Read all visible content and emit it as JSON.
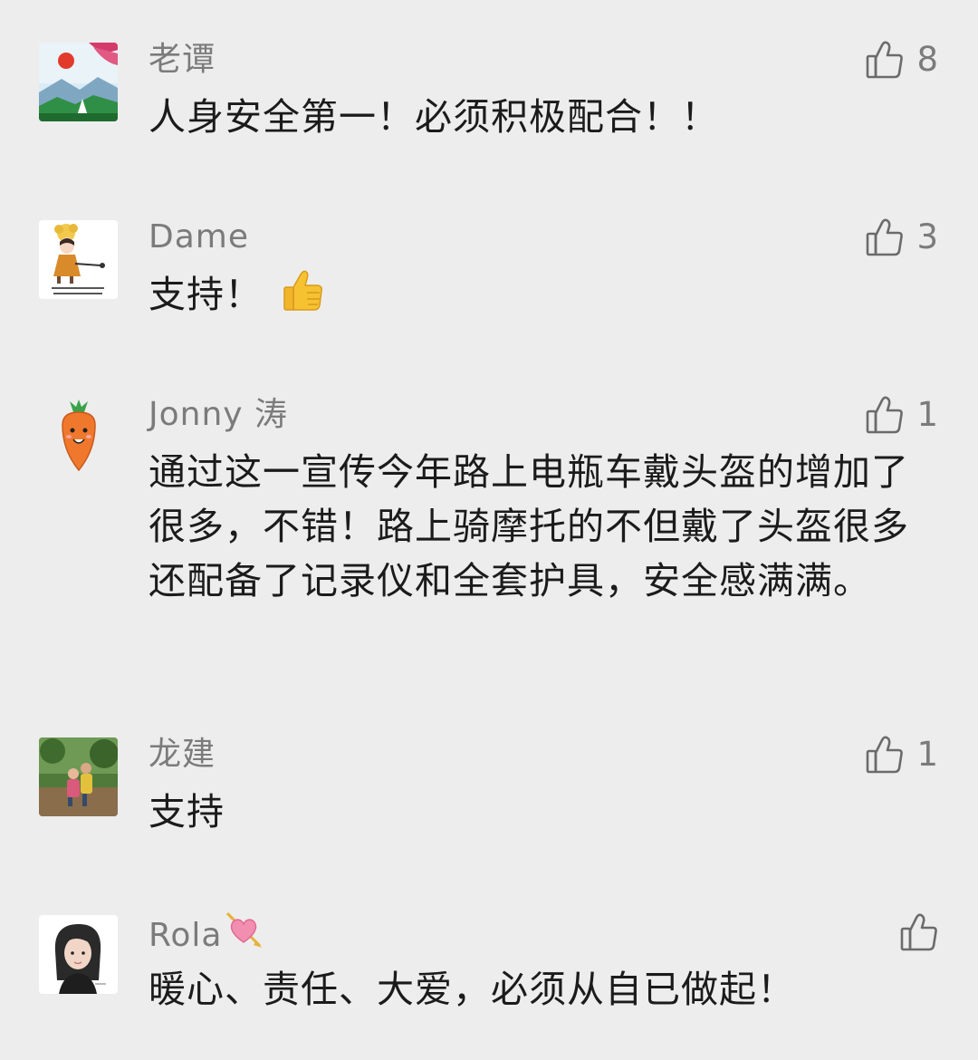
{
  "comments": [
    {
      "name": "老谭",
      "text": "人身安全第一！必须积极配合！！",
      "likes": "8"
    },
    {
      "name": "Dame",
      "text": "支持！",
      "likes": "3"
    },
    {
      "name": "Jonny 涛",
      "text": "通过这一宣传今年路上电瓶车戴头盔的增加了很多，不错！路上骑摩托的不但戴了头盔很多还配备了记录仪和全套护具，安全感满满。",
      "likes": "1"
    },
    {
      "name": "龙建",
      "text": "支持",
      "likes": "1"
    },
    {
      "name": "Rola",
      "text": "暖心、责任、大爱，必须从自已做起！",
      "likes": ""
    }
  ],
  "icons": {
    "like": "thumbs-up-outline-icon",
    "emoji_thumbs_up": "thumbs-up-emoji",
    "heart_arrow": "heart-with-arrow-emoji"
  },
  "colors": {
    "background": "#ededed",
    "name_text": "#7b7b7b",
    "body_text": "#1b1b1b",
    "like_icon": "#6b6b6b"
  }
}
